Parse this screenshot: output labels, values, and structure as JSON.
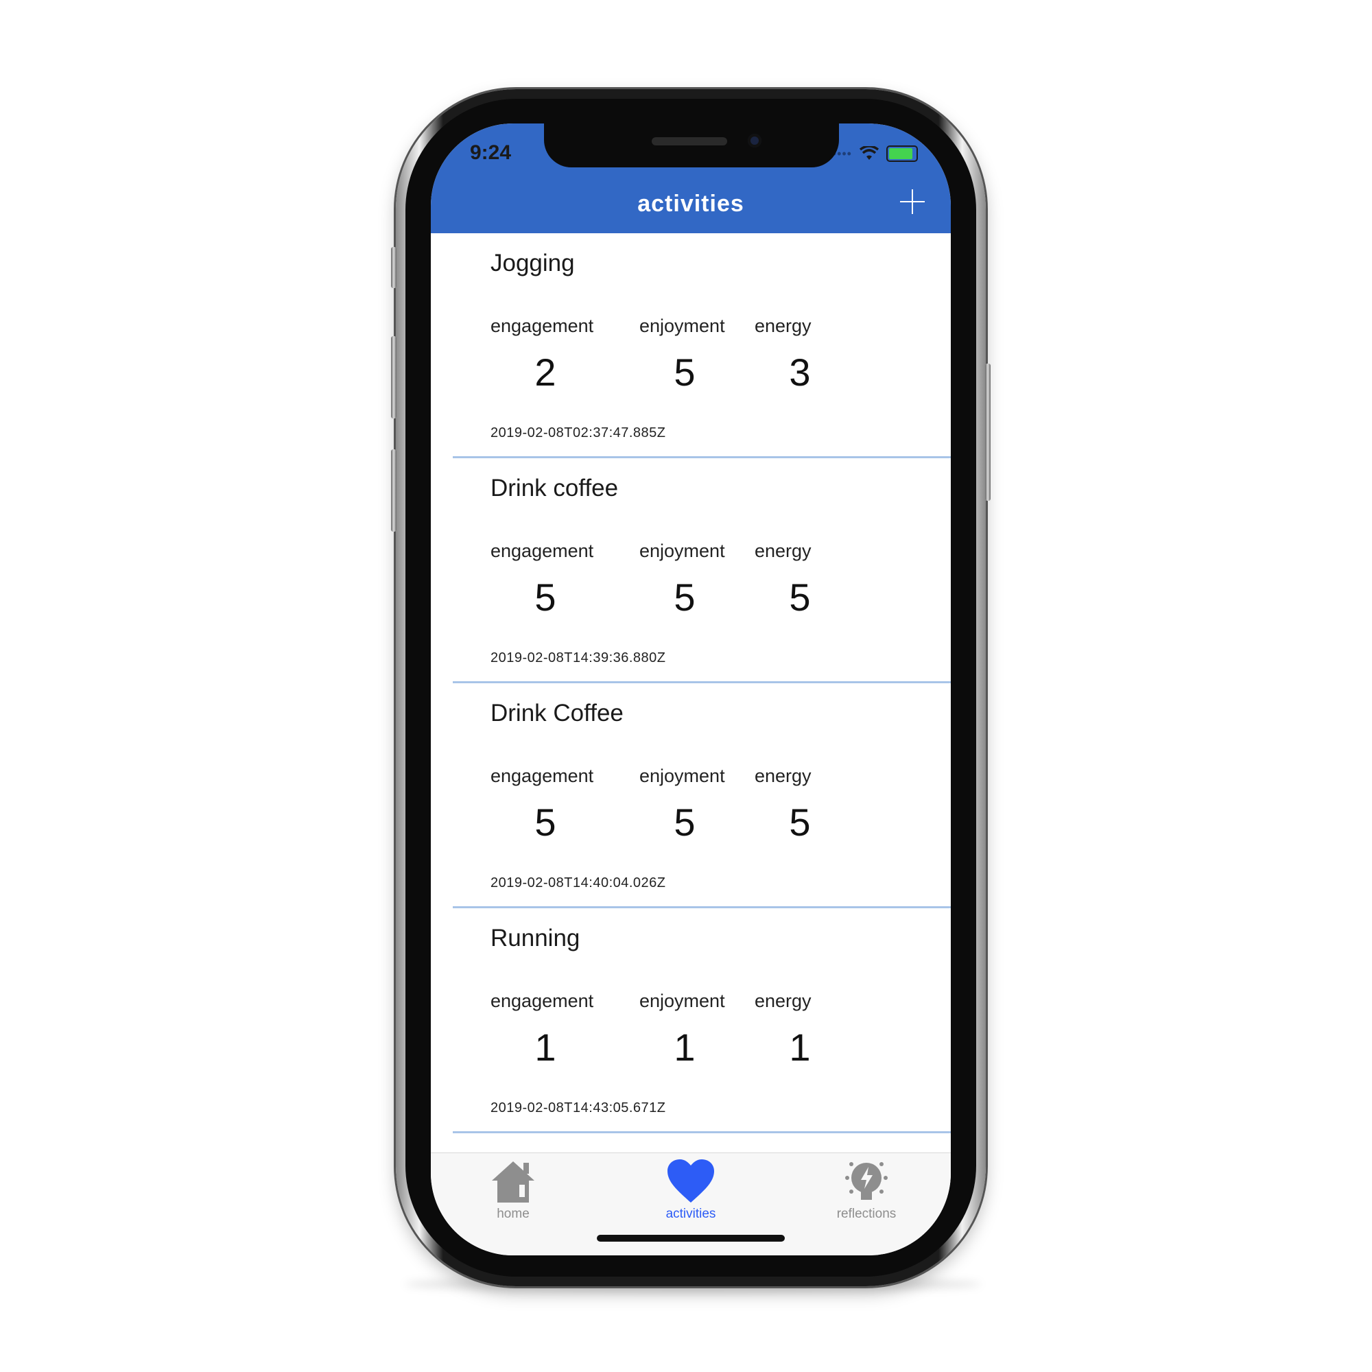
{
  "status_bar": {
    "time": "9:24"
  },
  "header": {
    "title": "activities"
  },
  "metric_labels": {
    "engagement": "engagement",
    "enjoyment": "enjoyment",
    "energy": "energy"
  },
  "activities": [
    {
      "name": "Jogging",
      "engagement": "2",
      "enjoyment": "5",
      "energy": "3",
      "timestamp": "2019-02-08T02:37:47.885Z"
    },
    {
      "name": "Drink coffee",
      "engagement": "5",
      "enjoyment": "5",
      "energy": "5",
      "timestamp": "2019-02-08T14:39:36.880Z"
    },
    {
      "name": "Drink Coffee",
      "engagement": "5",
      "enjoyment": "5",
      "energy": "5",
      "timestamp": "2019-02-08T14:40:04.026Z"
    },
    {
      "name": "Running",
      "engagement": "1",
      "enjoyment": "1",
      "energy": "1",
      "timestamp": "2019-02-08T14:43:05.671Z"
    }
  ],
  "tabs": [
    {
      "label": "home",
      "icon": "home-icon",
      "active": false
    },
    {
      "label": "activities",
      "icon": "heart-icon",
      "active": true
    },
    {
      "label": "reflections",
      "icon": "lightbulb-icon",
      "active": false
    }
  ],
  "colors": {
    "header": "#3268c5",
    "active_tab": "#2d5cf6",
    "inactive_tab": "#8e8e8e",
    "divider": "#a8c4e8"
  }
}
